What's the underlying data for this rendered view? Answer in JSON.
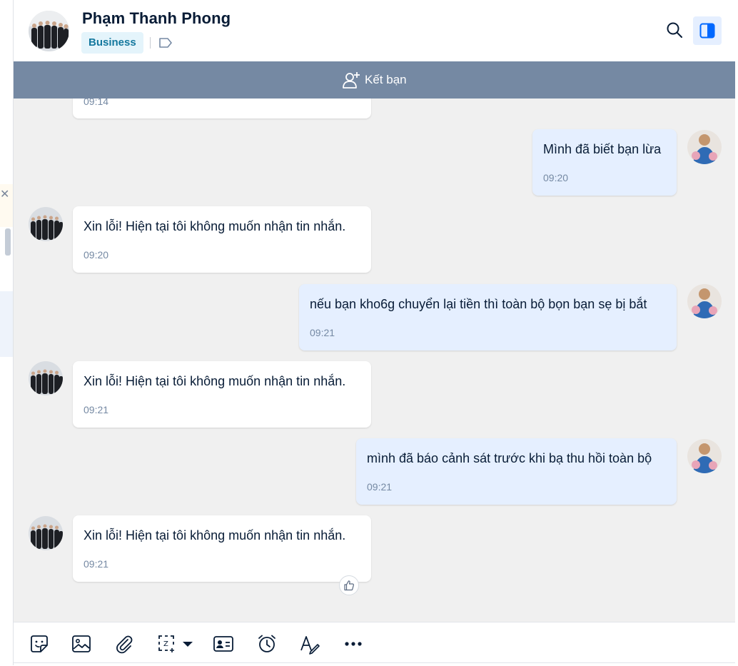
{
  "header": {
    "contact_name": "Phạm Thanh Phong",
    "badge": "Business"
  },
  "friend_bar": {
    "label": "Kết bạn"
  },
  "messages": [
    {
      "direction": "in",
      "text": "",
      "time": "09:14"
    },
    {
      "direction": "out",
      "text": "Mình đã biết bạn lừa",
      "time": "09:20"
    },
    {
      "direction": "in",
      "text": "Xin lỗi! Hiện tại tôi không muốn nhận tin nhắn.",
      "time": "09:20"
    },
    {
      "direction": "out",
      "text": "nếu bạn kho6g chuyển lại tiền thì toàn bộ bọn bạn sẹ bị bắt",
      "time": "09:21"
    },
    {
      "direction": "in",
      "text": "Xin lỗi! Hiện tại tôi không muốn nhận tin nhắn.",
      "time": "09:21"
    },
    {
      "direction": "out",
      "text": "mình đã báo cảnh sát trước khi bạ thu hồi toàn bộ",
      "time": "09:21"
    },
    {
      "direction": "in",
      "text": "Xin lỗi! Hiện tại tôi không muốn nhận tin nhắn.",
      "time": "09:21"
    }
  ],
  "toolbar": {
    "icons": [
      "sticker-icon",
      "image-icon",
      "attachment-icon",
      "screenshot-icon",
      "contact-card-icon",
      "reminder-icon",
      "text-format-icon",
      "more-icon"
    ]
  },
  "colors": {
    "friend_bar": "#7589a3",
    "outgoing_bubble": "#e5efff",
    "incoming_bubble": "#ffffff",
    "chat_background": "#f0f0f0",
    "badge_bg": "#e4f4fb",
    "badge_text": "#14789e",
    "accent": "#0068ff"
  }
}
